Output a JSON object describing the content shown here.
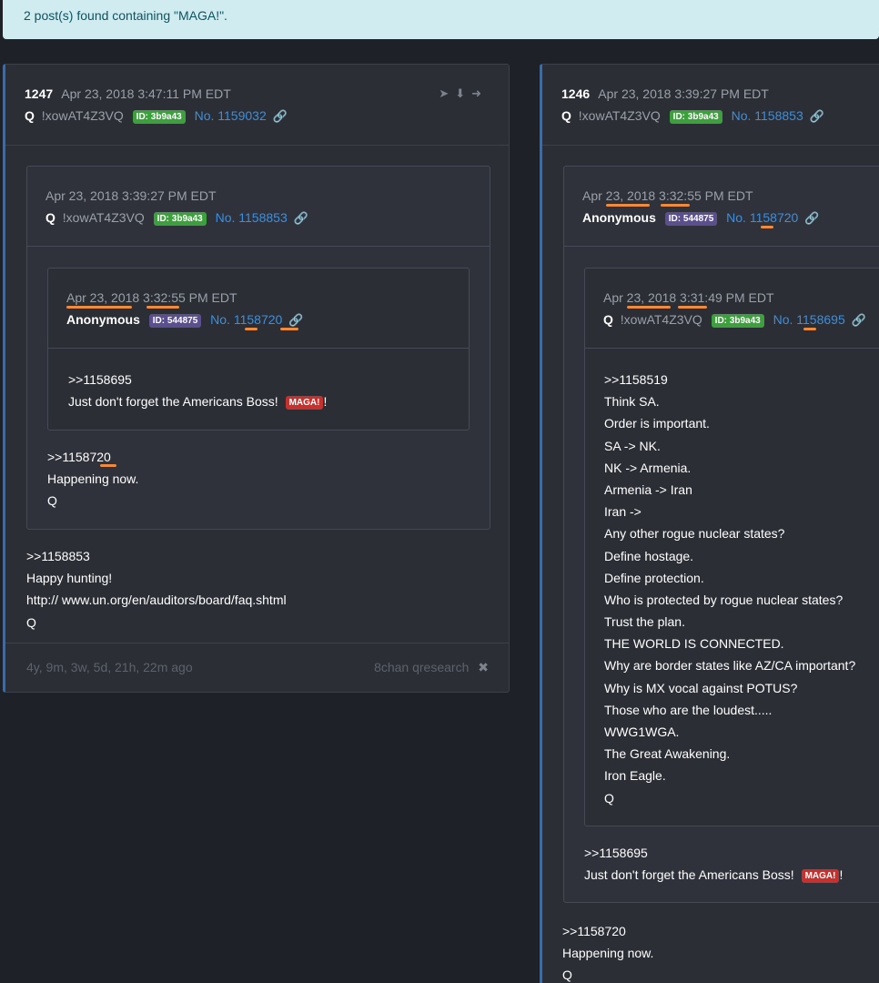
{
  "search": {
    "result_text": "2 post(s) found containing \"MAGA!\"."
  },
  "posts": [
    {
      "num": "1247",
      "date": "Apr 23, 2018 3:47:11 PM EDT",
      "author": "Q",
      "trip": "!xowAT4Z3VQ",
      "id_badge": "ID: 3b9a43",
      "post_no": "No. 1159032",
      "quote1": {
        "date": "Apr 23, 2018 3:39:27 PM EDT",
        "author": "Q",
        "trip": "!xowAT4Z3VQ",
        "id_badge": "ID: 3b9a43",
        "post_no": "No. 1158853",
        "quote2": {
          "date": "Apr 23, 2018 3:32:55 PM EDT",
          "author": "Anonymous",
          "id_badge": "ID: 544875",
          "post_no": "No. 1158720",
          "lines": [
            ">>1158695",
            "Just don't forget the Americans Boss!"
          ],
          "maga": "MAGA!",
          "maga_suffix": "!"
        },
        "lines": [
          ">>1158720",
          "Happening now.",
          "Q"
        ]
      },
      "lines": [
        ">>1158853",
        "Happy hunting!",
        "http:// www.un.org/en/auditors/board/faq.shtml",
        "Q"
      ],
      "footer_ago": "4y, 9m, 3w, 5d, 21h, 22m ago",
      "footer_source": "8chan qresearch"
    },
    {
      "num": "1246",
      "date": "Apr 23, 2018 3:39:27 PM EDT",
      "author": "Q",
      "trip": "!xowAT4Z3VQ",
      "id_badge": "ID: 3b9a43",
      "post_no": "No. 1158853",
      "quote1": {
        "date": "Apr 23, 2018 3:32:55 PM EDT",
        "author": "Anonymous",
        "id_badge": "ID: 544875",
        "post_no": "No. 1158720",
        "quote2": {
          "date": "Apr 23, 2018 3:31:49 PM EDT",
          "author": "Q",
          "trip": "!xowAT4Z3VQ",
          "id_badge": "ID: 3b9a43",
          "post_no": "No. 1158695",
          "lines": [
            ">>1158519",
            "Think SA.",
            "Order is important.",
            "SA -> NK.",
            "NK -> Armenia.",
            "Armenia -> Iran",
            "Iran ->",
            "Any other rogue nuclear states?",
            "Define hostage.",
            "Define protection.",
            "Who is protected by rogue nuclear states?",
            "Trust the plan.",
            "THE WORLD IS CONNECTED.",
            "Why are border states like AZ/CA important?",
            "Why is MX vocal against POTUS?",
            "Those who are the loudest.....",
            "WWG1WGA.",
            "The Great Awakening.",
            "Iron Eagle.",
            "Q"
          ]
        },
        "lines": [
          ">>1158695",
          "Just don't forget the Americans Boss!"
        ],
        "maga": "MAGA!",
        "maga_suffix": "!"
      },
      "lines": [
        ">>1158720",
        "Happening now.",
        "Q"
      ]
    }
  ],
  "icons": {
    "share": "share-icon",
    "download": "download-icon",
    "goto": "arrow-right-circle-icon",
    "link": "link-icon",
    "close": "close-circle-icon"
  },
  "colors": {
    "alert_bg": "#d1ecf1",
    "accent_blue": "#3b8fe0",
    "id_green": "#3ca03c",
    "id_purple": "#5b4f8f",
    "maga_red": "#c8302e",
    "highlight_orange": "#f08a3c"
  }
}
